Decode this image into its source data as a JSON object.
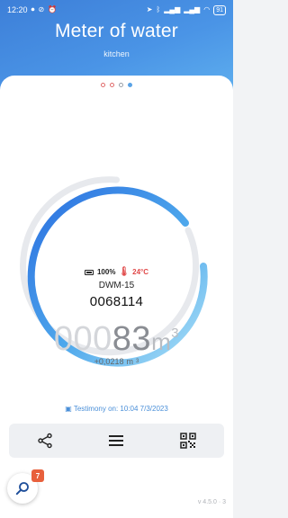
{
  "status_bar": {
    "time": "12:20",
    "battery": "91",
    "icons": [
      "screen-record-icon",
      "do-not-disturb-icon",
      "alarm-icon",
      "location-icon",
      "bluetooth-icon",
      "signal-icon",
      "signal-icon",
      "wifi-icon"
    ]
  },
  "header": {
    "title": "Meter of water",
    "subtitle": "kitchen"
  },
  "pager": {
    "count": 4,
    "active_index": 3
  },
  "gauge": {
    "colors": {
      "start": "#2b6fe0",
      "end": "#aee2f7",
      "track": "#e7e9ed"
    }
  },
  "device": {
    "battery": "100%",
    "temperature": "24°C",
    "model": "DWM-15",
    "serial": "0068114"
  },
  "reading": {
    "leading_zeros": "000",
    "value": "83",
    "unit": "m",
    "unit_sup": "3"
  },
  "delta": {
    "value": "+0,0218",
    "unit": "m",
    "unit_sup": "3"
  },
  "testimony": "Testimony on: 10:04 7/3/2023",
  "toolbar": {
    "share_icon": "share-icon",
    "menu_icon": "menu-icon",
    "qr_icon": "qr-code-icon"
  },
  "fab": {
    "icon": "search-icon",
    "badge": "7"
  },
  "version": "v 4.5.0 · 3"
}
